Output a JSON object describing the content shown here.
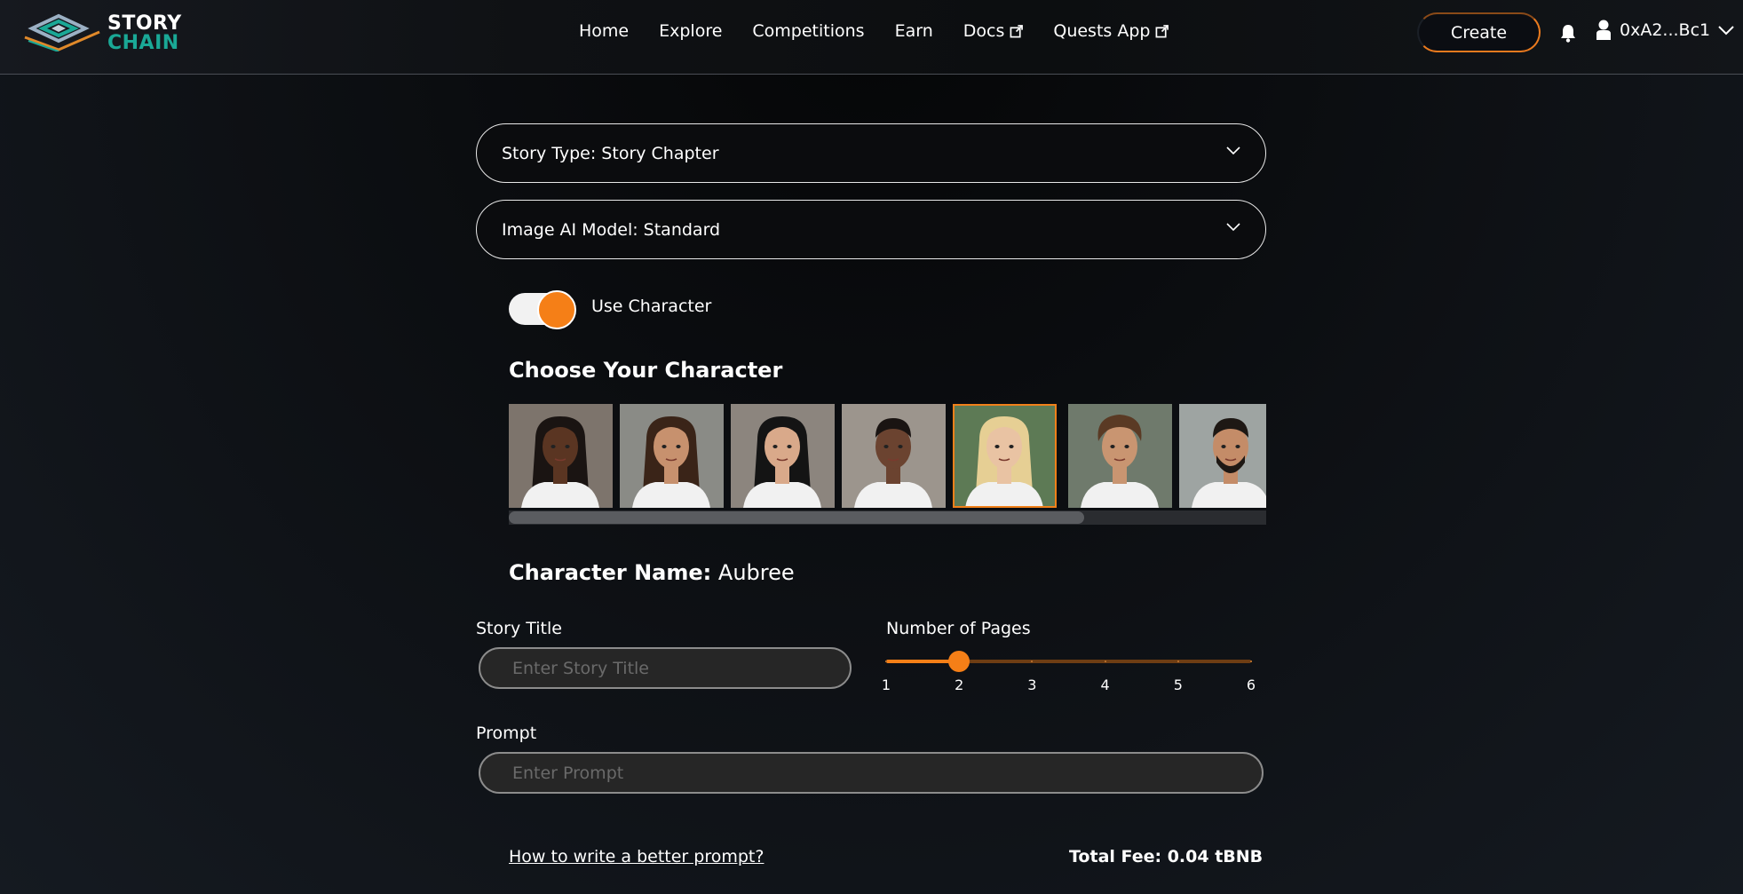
{
  "brand": {
    "line1": "STORY",
    "line2": "CHAIN"
  },
  "nav": [
    {
      "label": "Home",
      "external": false
    },
    {
      "label": "Explore",
      "external": false
    },
    {
      "label": "Competitions",
      "external": false
    },
    {
      "label": "Earn",
      "external": false
    },
    {
      "label": "Docs",
      "external": true
    },
    {
      "label": "Quests App",
      "external": true
    }
  ],
  "header": {
    "create_label": "Create",
    "wallet": "0xA2...Bc1"
  },
  "form": {
    "story_type": "Story Type: Story Chapter",
    "image_model": "Image AI Model: Standard",
    "use_character_label": "Use Character",
    "use_character_on": true,
    "choose_title": "Choose Your Character",
    "character_name_label": "Character Name:",
    "character_name": "Aubree",
    "story_title_label": "Story Title",
    "story_title_placeholder": "Enter Story Title",
    "pages_label": "Number of Pages",
    "pages_value": 2,
    "pages_ticks": [
      "1",
      "2",
      "3",
      "4",
      "5",
      "6"
    ],
    "prompt_label": "Prompt",
    "prompt_placeholder": "Enter Prompt",
    "help_link": "How to write a better prompt?",
    "total_fee": "Total Fee: 0.04 tBNB"
  },
  "characters": [
    {
      "bg": "#7d746c",
      "skin": "#5a3522",
      "hair": "#1a1412",
      "hair_style": "braids",
      "selected": false
    },
    {
      "bg": "#8a8b86",
      "skin": "#c7916e",
      "hair": "#3a2418",
      "hair_style": "long",
      "selected": false
    },
    {
      "bg": "#8c857e",
      "skin": "#d9a98a",
      "hair": "#141414",
      "hair_style": "long",
      "selected": false
    },
    {
      "bg": "#9c958d",
      "skin": "#6b4330",
      "hair": "#1a1412",
      "hair_style": "short",
      "selected": false
    },
    {
      "bg": "#5d7a55",
      "skin": "#e9c3a3",
      "hair": "#e6cf94",
      "hair_style": "long",
      "selected": true
    },
    {
      "bg": "#6f7a6c",
      "skin": "#c99571",
      "hair": "#5a3a24",
      "hair_style": "wavy",
      "selected": false
    },
    {
      "bg": "#9ea4a2",
      "skin": "#c48c68",
      "hair": "#1e1814",
      "hair_style": "short-beard",
      "selected": false
    }
  ],
  "colors": {
    "accent": "#f57f17",
    "teal": "#1aa896"
  }
}
